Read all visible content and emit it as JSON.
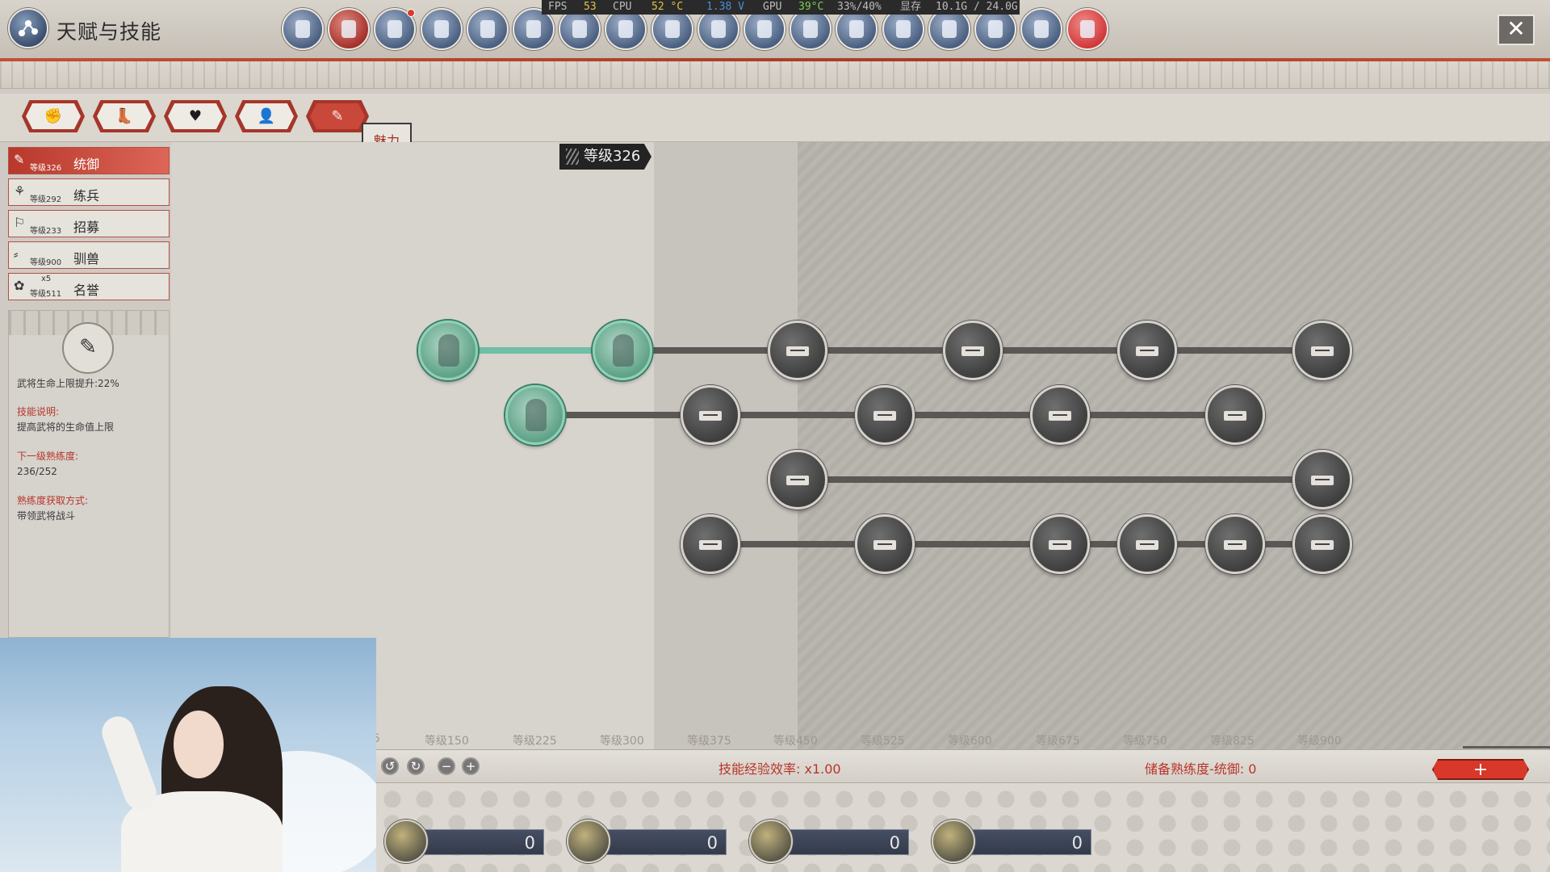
{
  "window": {
    "title": "天赋与技能",
    "close_label": "✕"
  },
  "perf": {
    "fps_label": "FPS",
    "fps": "53",
    "cpu_label": "CPU",
    "cpu_temp": "52 °C",
    "voltage": "1.38 V",
    "gpu_label": "GPU",
    "gpu_temp": "39°C",
    "gpu_usage": "33%/40%",
    "mem_label": "显存",
    "mem": "10.1G / 24.0G"
  },
  "top_icons": [
    {
      "name": "helmet-icon",
      "state": "normal"
    },
    {
      "name": "talent-network-icon",
      "state": "active"
    },
    {
      "name": "inventory-icon",
      "state": "notify"
    },
    {
      "name": "banner-icon",
      "state": "normal"
    },
    {
      "name": "scroll-icon",
      "state": "normal"
    },
    {
      "name": "fan-icon",
      "state": "normal"
    },
    {
      "name": "target-icon",
      "state": "normal"
    },
    {
      "name": "dragon-icon",
      "state": "normal"
    },
    {
      "name": "mask-icon",
      "state": "normal"
    },
    {
      "name": "shield-icon",
      "state": "normal"
    },
    {
      "name": "chest-icon",
      "state": "normal"
    },
    {
      "name": "edict-icon",
      "state": "normal"
    },
    {
      "name": "book-icon",
      "state": "normal"
    },
    {
      "name": "tablet-icon",
      "state": "normal"
    },
    {
      "name": "buildings-icon",
      "state": "normal"
    },
    {
      "name": "council-icon",
      "state": "normal"
    },
    {
      "name": "warrior-icon",
      "state": "normal"
    },
    {
      "name": "tome-icon",
      "state": "special"
    }
  ],
  "category_tabs": [
    {
      "name": "tab-strength",
      "glyph": "✊",
      "active": false
    },
    {
      "name": "tab-agility",
      "glyph": "👢",
      "active": false
    },
    {
      "name": "tab-vitality",
      "glyph": "♥",
      "active": false
    },
    {
      "name": "tab-intellect",
      "glyph": "👤",
      "active": false
    },
    {
      "name": "tab-charisma",
      "glyph": "✎",
      "active": true
    }
  ],
  "tooltip": {
    "text": "魅力"
  },
  "skills": [
    {
      "icon": "✎",
      "level": "等级326",
      "extra": "",
      "name": "统御",
      "active": true
    },
    {
      "icon": "⚘",
      "level": "等级292",
      "extra": "",
      "name": "练兵",
      "active": false
    },
    {
      "icon": "⚐",
      "level": "等级233",
      "extra": "",
      "name": "招募",
      "active": false
    },
    {
      "icon": "⸗",
      "level": "等级900",
      "extra": "",
      "name": "驯兽",
      "active": false
    },
    {
      "icon": "✿",
      "level": "等级511",
      "extra": "x5",
      "name": "名誉",
      "active": false
    }
  ],
  "detail": {
    "icon": "✎",
    "effect": "武将生命上限提升:22%",
    "desc_title": "技能说明:",
    "desc": "提高武将的生命值上限",
    "next_title": "下一级熟练度:",
    "next_value": "236/252",
    "source_title": "熟练度获取方式:",
    "source": "带领武将战斗"
  },
  "tree": {
    "level_badge": "等级326",
    "levels": [
      "5",
      "等级150",
      "等级225",
      "等级300",
      "等级375",
      "等级450",
      "等级525",
      "等级600",
      "等级675",
      "等级750",
      "等级825",
      "等级900"
    ]
  },
  "status": {
    "efficiency": "技能经验效率: x1.00",
    "reserve": "储备熟练度-统御: 0",
    "add_label": "+"
  },
  "resources": [
    {
      "name": "resource-coin",
      "value": "0"
    },
    {
      "name": "resource-herb",
      "value": "0"
    },
    {
      "name": "resource-cycle",
      "value": "0"
    },
    {
      "name": "resource-pot",
      "value": "0"
    }
  ]
}
